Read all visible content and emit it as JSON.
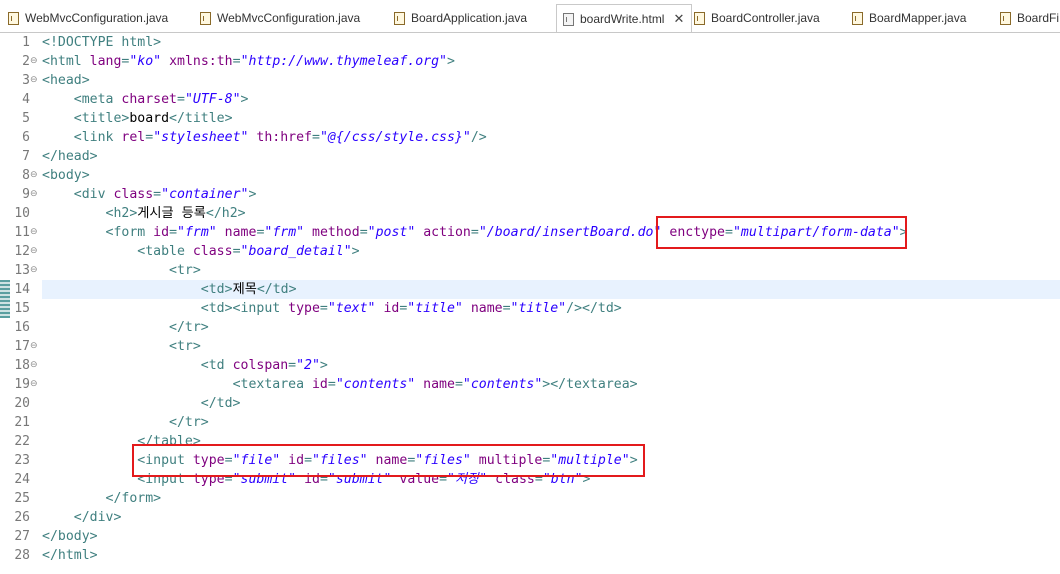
{
  "tabs": [
    {
      "label": "WebMvcConfiguration.java",
      "icon": "java-file-icon",
      "active": false
    },
    {
      "label": "WebMvcConfiguration.java",
      "icon": "java-file-icon",
      "active": false
    },
    {
      "label": "BoardApplication.java",
      "icon": "java-file-icon",
      "active": false
    },
    {
      "label": "boardWrite.html",
      "icon": "html-file-icon",
      "active": true,
      "close": "✕"
    },
    {
      "label": "BoardController.java",
      "icon": "java-file-icon",
      "active": false
    },
    {
      "label": "BoardMapper.java",
      "icon": "java-file-icon",
      "active": false
    },
    {
      "label": "BoardFi",
      "icon": "java-file-icon",
      "active": false
    }
  ],
  "colors": {
    "tag": "#3f7f7f",
    "attr": "#7f007f",
    "value": "#2a00ff",
    "text": "#000000",
    "current_line": "#e8f2fe",
    "highlight_box": "#e31a1c"
  },
  "current_line": 14,
  "fold_lines": [
    2,
    3,
    8,
    9,
    11,
    12,
    13,
    17,
    18,
    19
  ],
  "highlights": [
    {
      "name": "enctype-highlight",
      "line": 11
    },
    {
      "name": "file-input-highlight",
      "line": 23
    }
  ],
  "lines": [
    {
      "n": "1",
      "seg": [
        [
          "tag",
          "<!DOCTYPE html>"
        ]
      ]
    },
    {
      "n": "2",
      "seg": [
        [
          "tag",
          "<html "
        ],
        [
          "attr",
          "lang"
        ],
        [
          "tag",
          "="
        ],
        [
          "value",
          "\"ko\""
        ],
        [
          "tag",
          " "
        ],
        [
          "attr",
          "xmlns:th"
        ],
        [
          "tag",
          "="
        ],
        [
          "value",
          "\"http://www.thymeleaf.org\""
        ],
        [
          "tag",
          ">"
        ]
      ]
    },
    {
      "n": "3",
      "seg": [
        [
          "tag",
          "<head>"
        ]
      ]
    },
    {
      "n": "4",
      "seg": [
        [
          "text",
          "    "
        ],
        [
          "tag",
          "<meta "
        ],
        [
          "attr",
          "charset"
        ],
        [
          "tag",
          "="
        ],
        [
          "value",
          "\"UTF-8\""
        ],
        [
          "tag",
          ">"
        ]
      ]
    },
    {
      "n": "5",
      "seg": [
        [
          "text",
          "    "
        ],
        [
          "tag",
          "<title>"
        ],
        [
          "text",
          "board"
        ],
        [
          "tag",
          "</title>"
        ]
      ]
    },
    {
      "n": "6",
      "seg": [
        [
          "text",
          "    "
        ],
        [
          "tag",
          "<link "
        ],
        [
          "attr",
          "rel"
        ],
        [
          "tag",
          "="
        ],
        [
          "value",
          "\"stylesheet\""
        ],
        [
          "tag",
          " "
        ],
        [
          "attr",
          "th:href"
        ],
        [
          "tag",
          "="
        ],
        [
          "value",
          "\"@{/css/style.css}\""
        ],
        [
          "tag",
          "/>"
        ]
      ]
    },
    {
      "n": "7",
      "seg": [
        [
          "tag",
          "</head>"
        ]
      ]
    },
    {
      "n": "8",
      "seg": [
        [
          "tag",
          "<body>"
        ]
      ]
    },
    {
      "n": "9",
      "seg": [
        [
          "text",
          "    "
        ],
        [
          "tag",
          "<div "
        ],
        [
          "attr",
          "class"
        ],
        [
          "tag",
          "="
        ],
        [
          "value",
          "\"container\""
        ],
        [
          "tag",
          ">"
        ]
      ]
    },
    {
      "n": "10",
      "seg": [
        [
          "text",
          "        "
        ],
        [
          "tag",
          "<h2>"
        ],
        [
          "text",
          "게시글 등록"
        ],
        [
          "tag",
          "</h2>"
        ]
      ]
    },
    {
      "n": "11",
      "seg": [
        [
          "text",
          "        "
        ],
        [
          "tag",
          "<form "
        ],
        [
          "attr",
          "id"
        ],
        [
          "tag",
          "="
        ],
        [
          "value",
          "\"frm\""
        ],
        [
          "tag",
          " "
        ],
        [
          "attr",
          "name"
        ],
        [
          "tag",
          "="
        ],
        [
          "value",
          "\"frm\""
        ],
        [
          "tag",
          " "
        ],
        [
          "attr",
          "method"
        ],
        [
          "tag",
          "="
        ],
        [
          "value",
          "\"post\""
        ],
        [
          "tag",
          " "
        ],
        [
          "attr",
          "action"
        ],
        [
          "tag",
          "="
        ],
        [
          "value",
          "\"/board/insertBoard.do\""
        ],
        [
          "tag",
          " "
        ],
        [
          "attr",
          "enctype"
        ],
        [
          "tag",
          "="
        ],
        [
          "value",
          "\"multipart/form-data\""
        ],
        [
          "tag",
          ">"
        ]
      ]
    },
    {
      "n": "12",
      "seg": [
        [
          "text",
          "            "
        ],
        [
          "tag",
          "<table "
        ],
        [
          "attr",
          "class"
        ],
        [
          "tag",
          "="
        ],
        [
          "value",
          "\"board_detail\""
        ],
        [
          "tag",
          ">"
        ]
      ]
    },
    {
      "n": "13",
      "seg": [
        [
          "text",
          "                "
        ],
        [
          "tag",
          "<tr>"
        ]
      ]
    },
    {
      "n": "14",
      "seg": [
        [
          "text",
          "                    "
        ],
        [
          "tag",
          "<td>"
        ],
        [
          "text",
          "제목"
        ],
        [
          "tag",
          "</td>"
        ]
      ]
    },
    {
      "n": "15",
      "seg": [
        [
          "text",
          "                    "
        ],
        [
          "tag",
          "<td><input "
        ],
        [
          "attr",
          "type"
        ],
        [
          "tag",
          "="
        ],
        [
          "value",
          "\"text\""
        ],
        [
          "tag",
          " "
        ],
        [
          "attr",
          "id"
        ],
        [
          "tag",
          "="
        ],
        [
          "value",
          "\"title\""
        ],
        [
          "tag",
          " "
        ],
        [
          "attr",
          "name"
        ],
        [
          "tag",
          "="
        ],
        [
          "value",
          "\"title\""
        ],
        [
          "tag",
          "/></td>"
        ]
      ]
    },
    {
      "n": "16",
      "seg": [
        [
          "text",
          "                "
        ],
        [
          "tag",
          "</tr>"
        ]
      ]
    },
    {
      "n": "17",
      "seg": [
        [
          "text",
          "                "
        ],
        [
          "tag",
          "<tr>"
        ]
      ]
    },
    {
      "n": "18",
      "seg": [
        [
          "text",
          "                    "
        ],
        [
          "tag",
          "<td "
        ],
        [
          "attr",
          "colspan"
        ],
        [
          "tag",
          "="
        ],
        [
          "value",
          "\"2\""
        ],
        [
          "tag",
          ">"
        ]
      ]
    },
    {
      "n": "19",
      "seg": [
        [
          "text",
          "                        "
        ],
        [
          "tag",
          "<textarea "
        ],
        [
          "attr",
          "id"
        ],
        [
          "tag",
          "="
        ],
        [
          "value",
          "\"contents\""
        ],
        [
          "tag",
          " "
        ],
        [
          "attr",
          "name"
        ],
        [
          "tag",
          "="
        ],
        [
          "value",
          "\"contents\""
        ],
        [
          "tag",
          "></textarea>"
        ]
      ]
    },
    {
      "n": "20",
      "seg": [
        [
          "text",
          "                    "
        ],
        [
          "tag",
          "</td>"
        ]
      ]
    },
    {
      "n": "21",
      "seg": [
        [
          "text",
          "                "
        ],
        [
          "tag",
          "</tr>"
        ]
      ]
    },
    {
      "n": "22",
      "seg": [
        [
          "text",
          "            "
        ],
        [
          "tag",
          "</table>"
        ]
      ]
    },
    {
      "n": "23",
      "seg": [
        [
          "text",
          "            "
        ],
        [
          "tag",
          "<input "
        ],
        [
          "attr",
          "type"
        ],
        [
          "tag",
          "="
        ],
        [
          "value",
          "\"file\""
        ],
        [
          "tag",
          " "
        ],
        [
          "attr",
          "id"
        ],
        [
          "tag",
          "="
        ],
        [
          "value",
          "\"files\""
        ],
        [
          "tag",
          " "
        ],
        [
          "attr",
          "name"
        ],
        [
          "tag",
          "="
        ],
        [
          "value",
          "\"files\""
        ],
        [
          "tag",
          " "
        ],
        [
          "attr",
          "multiple"
        ],
        [
          "tag",
          "="
        ],
        [
          "value",
          "\"multiple\""
        ],
        [
          "tag",
          ">"
        ]
      ]
    },
    {
      "n": "24",
      "seg": [
        [
          "text",
          "            "
        ],
        [
          "tag",
          "<input "
        ],
        [
          "attr",
          "type"
        ],
        [
          "tag",
          "="
        ],
        [
          "value",
          "\"submit\""
        ],
        [
          "tag",
          " "
        ],
        [
          "attr",
          "id"
        ],
        [
          "tag",
          "="
        ],
        [
          "value",
          "\"submit\""
        ],
        [
          "tag",
          " "
        ],
        [
          "attr",
          "value"
        ],
        [
          "tag",
          "="
        ],
        [
          "value",
          "\"저장\""
        ],
        [
          "tag",
          " "
        ],
        [
          "attr",
          "class"
        ],
        [
          "tag",
          "="
        ],
        [
          "value",
          "\"btn\""
        ],
        [
          "tag",
          ">"
        ]
      ]
    },
    {
      "n": "25",
      "seg": [
        [
          "text",
          "        "
        ],
        [
          "tag",
          "</form>"
        ]
      ]
    },
    {
      "n": "26",
      "seg": [
        [
          "text",
          "    "
        ],
        [
          "tag",
          "</div>"
        ]
      ]
    },
    {
      "n": "27",
      "seg": [
        [
          "tag",
          "</body>"
        ]
      ]
    },
    {
      "n": "28",
      "seg": [
        [
          "tag",
          "</html>"
        ]
      ]
    }
  ]
}
